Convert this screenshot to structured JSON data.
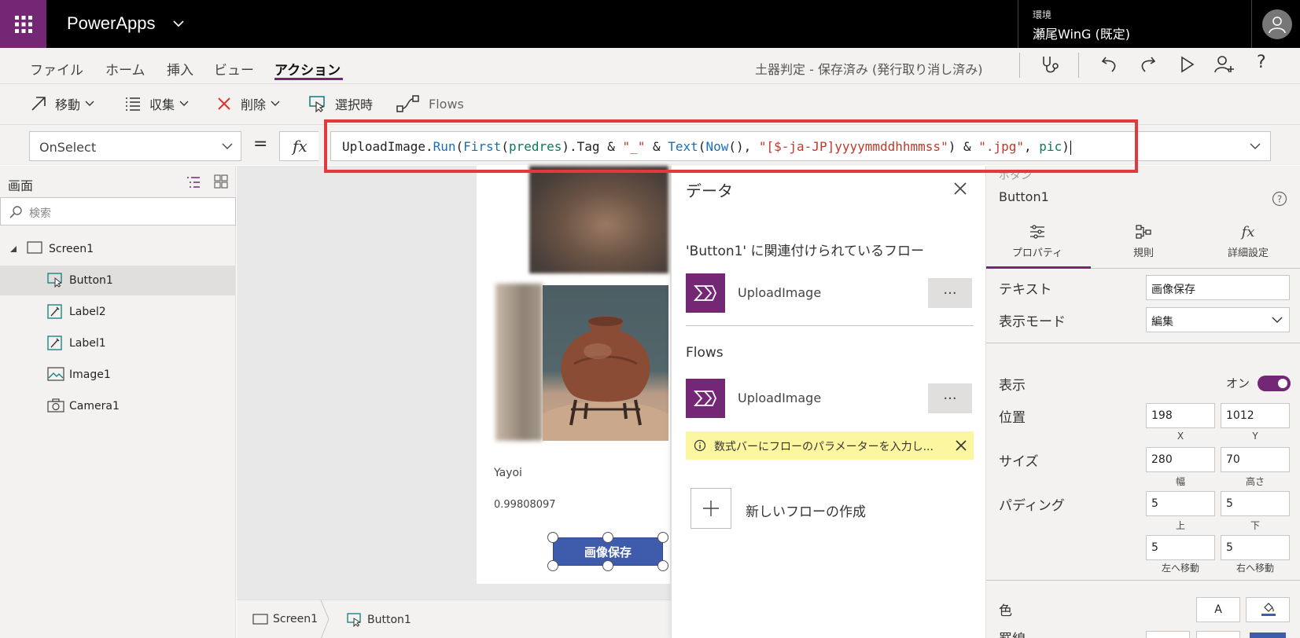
{
  "app": {
    "title": "PowerApps",
    "environment_label": "環境",
    "environment_name": "瀬尾WinG (既定)"
  },
  "menu": {
    "items": [
      "ファイル",
      "ホーム",
      "挿入",
      "ビュー",
      "アクション"
    ],
    "active": "アクション",
    "doc_status": "土器判定 - 保存済み (発行取り消し済み)"
  },
  "commands": {
    "move": "移動",
    "collect": "収集",
    "delete": "削除",
    "on_select": "選択時",
    "flows": "Flows"
  },
  "formula": {
    "property": "OnSelect",
    "equals": "=",
    "fx": "fx",
    "tokens": [
      {
        "t": "UploadImage.",
        "c": "plain"
      },
      {
        "t": "Run",
        "c": "fn"
      },
      {
        "t": "(",
        "c": "plain"
      },
      {
        "t": "First",
        "c": "fn"
      },
      {
        "t": "(",
        "c": "plain"
      },
      {
        "t": "predres",
        "c": "var"
      },
      {
        "t": ").Tag & ",
        "c": "plain"
      },
      {
        "t": "\"_\"",
        "c": "str"
      },
      {
        "t": " & ",
        "c": "plain"
      },
      {
        "t": "Text",
        "c": "fn"
      },
      {
        "t": "(",
        "c": "plain"
      },
      {
        "t": "Now",
        "c": "fn"
      },
      {
        "t": "(), ",
        "c": "plain"
      },
      {
        "t": "\"[$-ja-JP]yyyymmddhhmmss\"",
        "c": "str"
      },
      {
        "t": ") & ",
        "c": "plain"
      },
      {
        "t": "\".jpg\"",
        "c": "str"
      },
      {
        "t": ", ",
        "c": "plain"
      },
      {
        "t": "pic",
        "c": "var"
      },
      {
        "t": ")",
        "c": "plain"
      }
    ]
  },
  "tree": {
    "title": "画面",
    "search_placeholder": "検索",
    "items": [
      {
        "label": "Screen1",
        "icon": "screen-icon",
        "level": 0,
        "selected": false
      },
      {
        "label": "Button1",
        "icon": "button-icon",
        "level": 1,
        "selected": true
      },
      {
        "label": "Label2",
        "icon": "label-icon",
        "level": 1,
        "selected": false
      },
      {
        "label": "Label1",
        "icon": "label-icon",
        "level": 1,
        "selected": false
      },
      {
        "label": "Image1",
        "icon": "image-icon",
        "level": 1,
        "selected": false
      },
      {
        "label": "Camera1",
        "icon": "camera-icon",
        "level": 1,
        "selected": false
      }
    ]
  },
  "canvas": {
    "label_text": "Yayoi",
    "score_text": "0.99808097",
    "button_text": "画像保存"
  },
  "breadcrumb": [
    "Screen1",
    "Button1"
  ],
  "flyout": {
    "title": "データ",
    "assoc_heading": "'Button1' に関連付けられているフロー",
    "assoc_flow": "UploadImage",
    "flows_heading": "Flows",
    "flow": "UploadImage",
    "more": "···",
    "info": "数式バーにフローのパラメーターを入力し...",
    "new_flow": "新しいフローの作成"
  },
  "props": {
    "type": "ボタン",
    "name": "Button1",
    "tabs": [
      "プロパティ",
      "規則",
      "詳細設定"
    ],
    "text_label": "テキスト",
    "text_value": "画像保存",
    "mode_label": "表示モード",
    "mode_value": "編集",
    "visible_label": "表示",
    "visible_value": "オン",
    "position_label": "位置",
    "pos_x": "198",
    "pos_y": "1012",
    "x_label": "X",
    "y_label": "Y",
    "size_label": "サイズ",
    "width": "280",
    "height": "70",
    "width_label": "幅",
    "height_label": "高さ",
    "padding_label": "パディング",
    "pad_top": "5",
    "pad_bottom": "5",
    "pad_left": "5",
    "pad_right": "5",
    "top_label": "上",
    "bottom_label": "下",
    "left_label": "左へ移動",
    "right_label": "右へ移動",
    "color_label": "色",
    "color_a": "A",
    "border_label": "罫線"
  },
  "colors": {
    "brand": "#742774",
    "highlight": "#e03a3e",
    "button": "#3f5bab",
    "info": "#fdf6a1"
  }
}
